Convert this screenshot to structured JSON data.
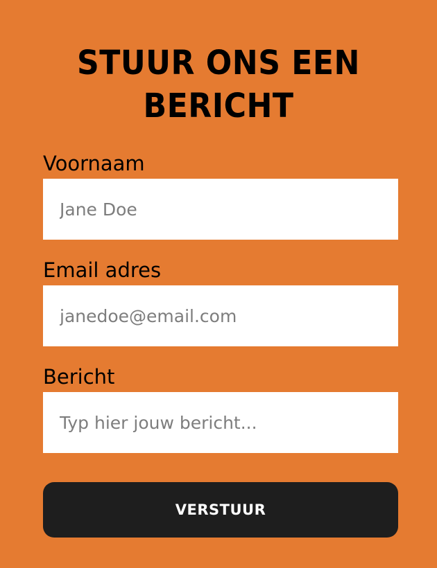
{
  "page": {
    "background_color": "#E57B31"
  },
  "form": {
    "title_line_1": "STUUR ONS EEN",
    "title_line_2": "BERICHT",
    "fields": [
      {
        "label": "Voornaam",
        "placeholder": "Jane Doe",
        "value": ""
      },
      {
        "label": "Email adres",
        "placeholder": "janedoe@email.com",
        "value": ""
      },
      {
        "label": "Bericht",
        "placeholder": "Typ hier jouw bericht...",
        "value": ""
      }
    ],
    "submit_label": "VERSTUUR",
    "submit_button_color": "#1E1E1E",
    "input_background_color": "#FFFFFF"
  }
}
